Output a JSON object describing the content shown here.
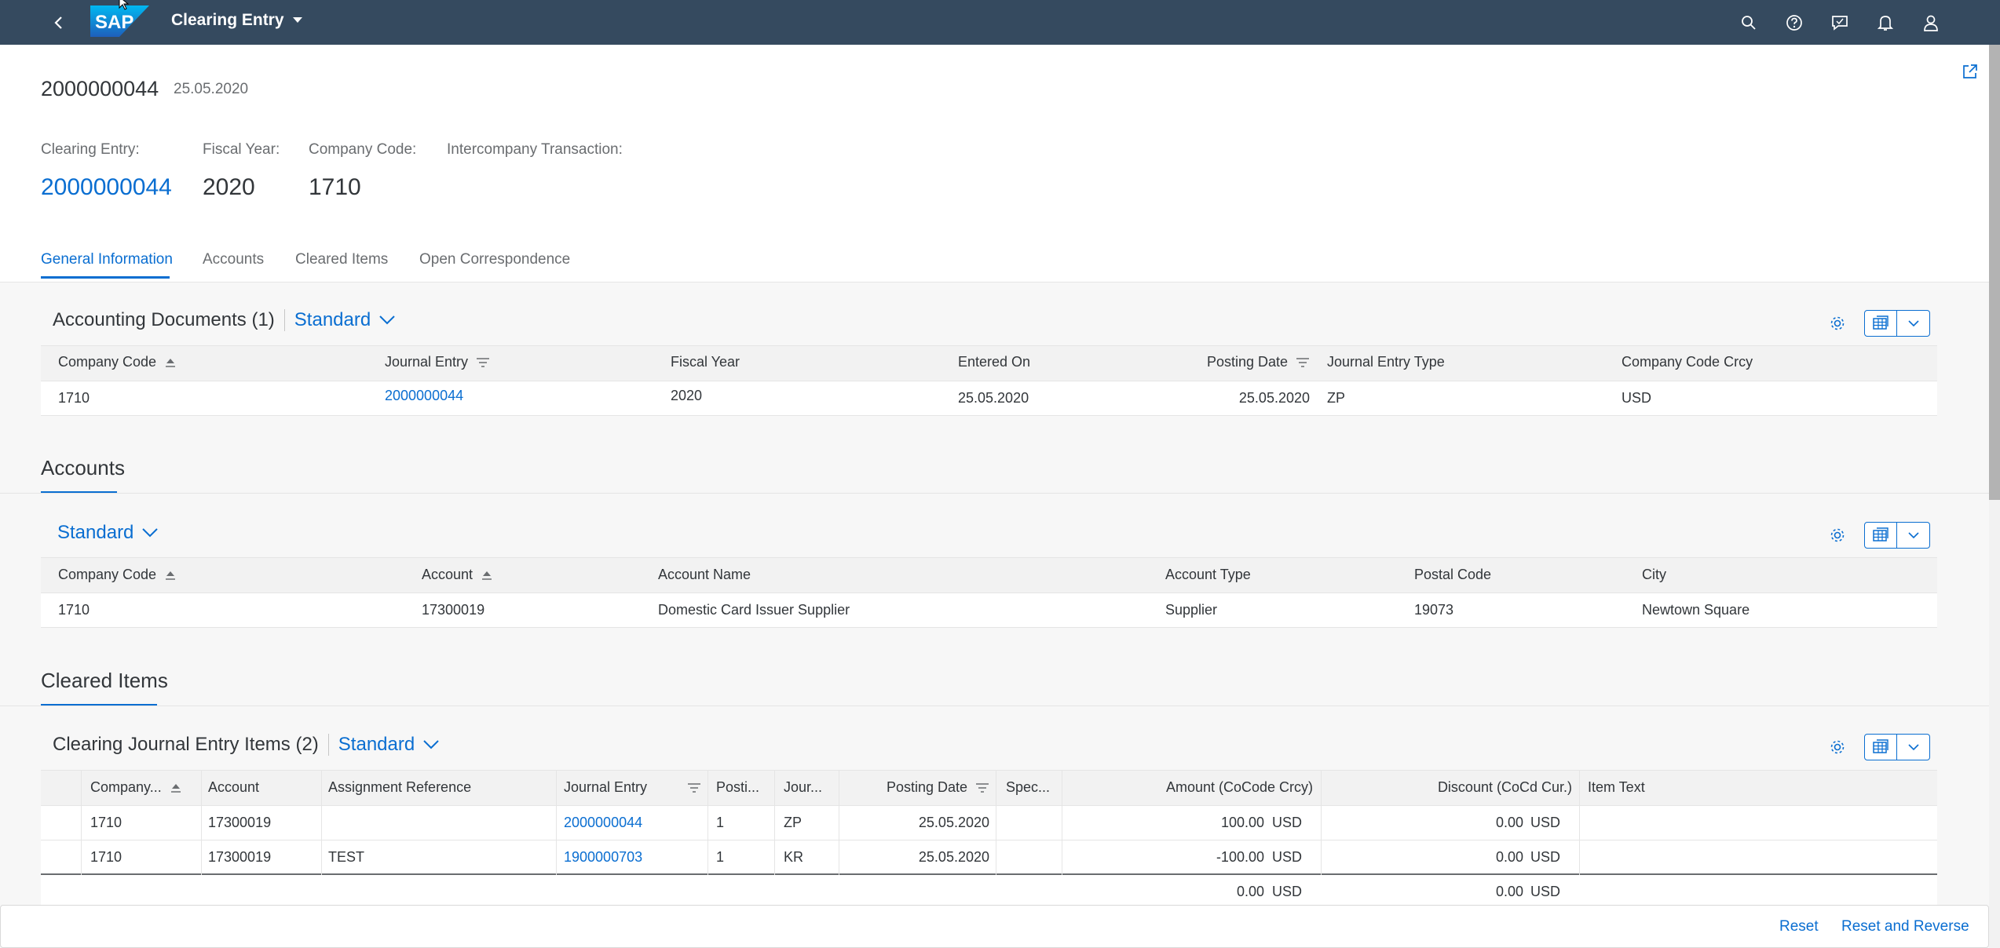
{
  "shell": {
    "app_title": "Clearing Entry",
    "logo_text": "SAP",
    "icons": [
      "back-icon",
      "search-icon",
      "help-icon",
      "feedback-icon",
      "notifications-icon",
      "user-icon"
    ]
  },
  "header": {
    "title": "2000000044",
    "subtitle": "25.05.2020",
    "fields": [
      {
        "label": "Clearing Entry:",
        "value": "2000000044"
      },
      {
        "label": "Fiscal Year:",
        "value": "2020"
      },
      {
        "label": "Company Code:",
        "value": "1710"
      },
      {
        "label": "Intercompany Transaction:",
        "value": ""
      }
    ]
  },
  "tabs": [
    "General Information",
    "Accounts",
    "Cleared Items",
    "Open Correspondence"
  ],
  "accounting_documents": {
    "title": "Accounting Documents (1)",
    "variant": "Standard",
    "columns": [
      "Company Code",
      "Journal Entry",
      "Fiscal Year",
      "Entered On",
      "Posting Date",
      "Journal Entry Type",
      "Company Code Crcy"
    ],
    "rows": [
      [
        "1710",
        "2000000044",
        "2020",
        "25.05.2020",
        "25.05.2020",
        "ZP",
        "USD"
      ]
    ]
  },
  "accounts": {
    "section_title": "Accounts",
    "variant": "Standard",
    "columns": [
      "Company Code",
      "Account",
      "Account Name",
      "Account Type",
      "Postal Code",
      "City"
    ],
    "rows": [
      [
        "1710",
        "17300019",
        "Domestic Card Issuer Supplier",
        "Supplier",
        "19073",
        "Newtown Square"
      ]
    ]
  },
  "cleared_items": {
    "section_title": "Cleared Items",
    "title": "Clearing Journal Entry Items (2)",
    "variant": "Standard",
    "columns": [
      "Company...",
      "Account",
      "Assignment Reference",
      "Journal Entry",
      "Posti...",
      "Jour...",
      "Posting Date",
      "Spec...",
      "Amount (CoCode Crcy)",
      "Discount (CoCd Cur.)",
      "Item Text"
    ],
    "rows": [
      [
        "1710",
        "17300019",
        "",
        "2000000044",
        "1",
        "ZP",
        "25.05.2020",
        "",
        "100.00",
        "USD",
        "0.00",
        "USD",
        ""
      ],
      [
        "1710",
        "17300019",
        "TEST",
        "1900000703",
        "1",
        "KR",
        "25.05.2020",
        "",
        "-100.00",
        "USD",
        "0.00",
        "USD",
        ""
      ]
    ],
    "totals": [
      "0.00",
      "USD",
      "0.00",
      "USD"
    ]
  },
  "footer": {
    "reset_label": "Reset",
    "reset_reverse_label": "Reset and Reverse"
  }
}
